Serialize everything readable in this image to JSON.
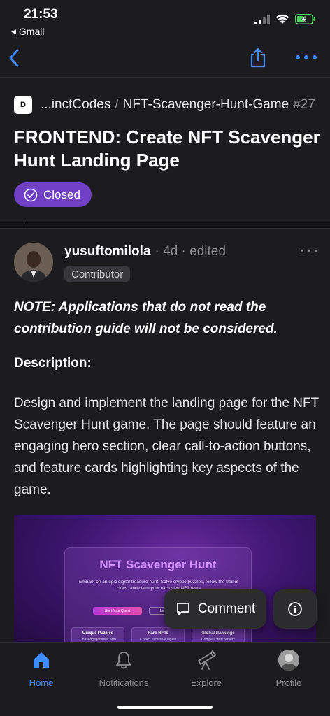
{
  "status_bar": {
    "time": "21:53",
    "back_app": "Gmail",
    "battery_color": "#4cd964"
  },
  "nav": {
    "accent": "#3d8bff"
  },
  "issue": {
    "repo_owner": "...inctCodes",
    "repo_name": "NFT-Scavenger-Hunt-Game",
    "number": "#27",
    "repo_avatar_text": "D",
    "title": "FRONTEND: Create NFT Scavenger Hunt Landing Page",
    "state": "Closed",
    "state_color": "#6f3fc4"
  },
  "comment": {
    "author": "yusuftomilola",
    "meta": "· 4d · edited",
    "role": "Contributor",
    "note": "NOTE: Applications that do not read the contribution guide will not be considered.",
    "description_heading": "Description:",
    "description_body": "Design and implement the landing page for the NFT Scavenger Hunt game. The page should feature an engaging hero section, clear call-to-action buttons, and feature cards highlighting key aspects of the game."
  },
  "preview": {
    "title": "NFT Scavenger Hunt",
    "subtitle": "Embark on an epic digital treasure hunt. Solve cryptic puzzles, follow the trail of clues, and claim your exclusive NFT rewa",
    "primary_button": "Start Your Quest",
    "secondary_button": "Lea",
    "features": [
      {
        "title": "Unique Puzzles",
        "desc": "Challenge yourself with"
      },
      {
        "title": "Rare NFTs",
        "desc": "Collect exclusive digital"
      },
      {
        "title": "Global Rankings",
        "desc": "Compete with players"
      }
    ]
  },
  "actions": {
    "comment_label": "Comment"
  },
  "tabs": [
    {
      "label": "Home",
      "icon": "home-icon",
      "active": true
    },
    {
      "label": "Notifications",
      "icon": "bell-icon",
      "active": false
    },
    {
      "label": "Explore",
      "icon": "telescope-icon",
      "active": false
    },
    {
      "label": "Profile",
      "icon": "profile-avatar",
      "active": false
    }
  ]
}
